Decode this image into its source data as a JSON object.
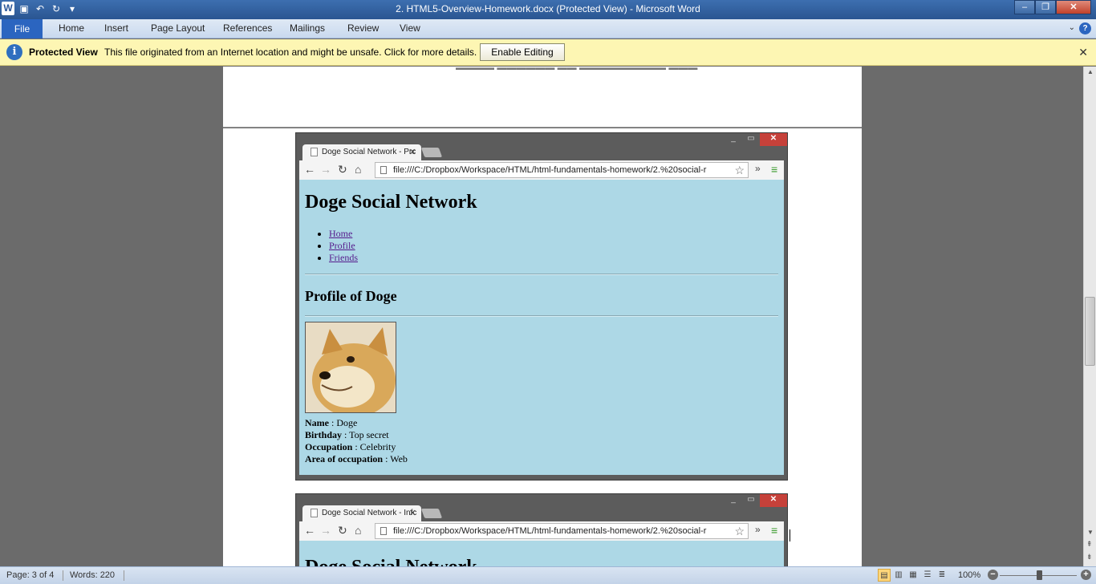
{
  "window": {
    "title": "2. HTML5-Overview-Homework.docx (Protected View)  -  Microsoft Word",
    "app_icon": "W",
    "controls": {
      "minimize": "–",
      "maximize": "❐",
      "close": "✕"
    }
  },
  "ribbon": {
    "file_tab": "File",
    "tabs": [
      "Home",
      "Insert",
      "Page Layout",
      "References",
      "Mailings",
      "Review",
      "View"
    ],
    "help": "?"
  },
  "protected_view": {
    "title": "Protected View",
    "message": "This file originated from an Internet location and might be unsafe. Click for more details.",
    "enable_button": "Enable Editing",
    "close": "✕"
  },
  "browser1": {
    "tab_title": "Doge Social Network - Prc",
    "url": "file:///C:/Dropbox/Workspace/HTML/html-fundamentals-homework/2.%20social-r",
    "page": {
      "heading": "Doge Social Network",
      "nav": [
        "Home",
        "Profile",
        "Friends"
      ],
      "subheading": "Profile of Doge",
      "details": [
        {
          "label": "Name",
          "value": " : Doge"
        },
        {
          "label": "Birthday",
          "value": " : Top secret"
        },
        {
          "label": "Occupation",
          "value": " : Celebrity"
        },
        {
          "label": "Area of occupation",
          "value": " : Web"
        }
      ]
    }
  },
  "browser2": {
    "tab_title": "Doge Social Network - Infc",
    "url": "file:///C:/Dropbox/Workspace/HTML/html-fundamentals-homework/2.%20social-r",
    "page": {
      "heading": "Doge Social Network"
    }
  },
  "statusbar": {
    "page": "Page: 3 of 4",
    "words": "Words: 220",
    "zoom": "100%",
    "zoom_level": 1.0
  }
}
